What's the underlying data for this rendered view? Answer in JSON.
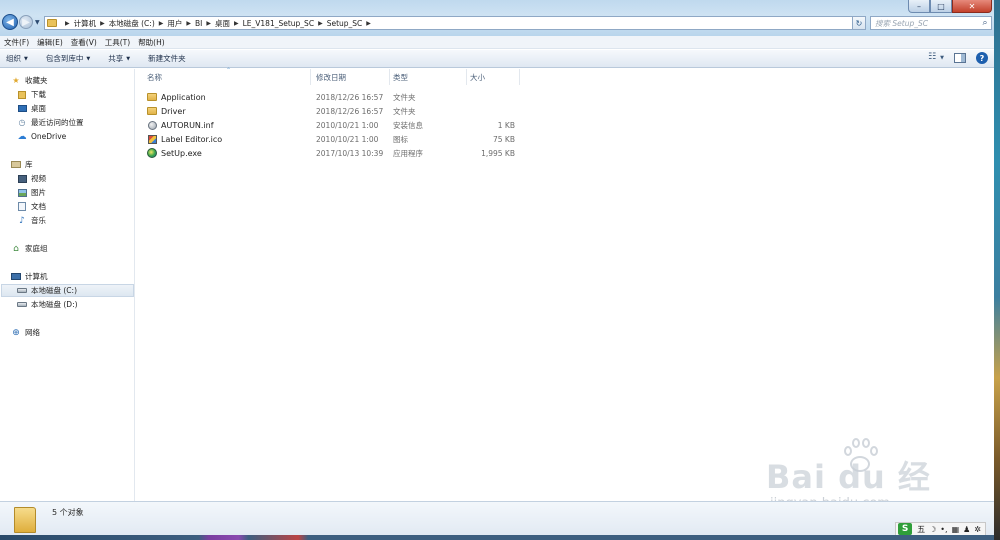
{
  "window": {
    "controls": {
      "minimize": "–",
      "maximize": "□",
      "close": "✕"
    }
  },
  "address": {
    "crumbs": [
      "计算机",
      "本地磁盘 (C:)",
      "用户",
      "BI",
      "桌面",
      "LE_V181_Setup_SC",
      "Setup_SC"
    ]
  },
  "search": {
    "placeholder": "搜索 Setup_SC"
  },
  "menu": [
    "文件(F)",
    "编辑(E)",
    "查看(V)",
    "工具(T)",
    "帮助(H)"
  ],
  "toolbar": {
    "organize": "组织",
    "include_library": "包含到库中",
    "share": "共享",
    "new_folder": "新建文件夹"
  },
  "nav": {
    "favorites": "收藏夹",
    "downloads": "下载",
    "desktop": "桌面",
    "recent": "最近访问的位置",
    "onedrive": "OneDrive",
    "libraries": "库",
    "videos": "视频",
    "pictures": "图片",
    "documents": "文档",
    "music": "音乐",
    "homegroup": "家庭组",
    "computer": "计算机",
    "drive_c": "本地磁盘 (C:)",
    "drive_d": "本地磁盘 (D:)",
    "network": "网络"
  },
  "columns": {
    "name": "名称",
    "date": "修改日期",
    "type": "类型",
    "size": "大小"
  },
  "files": [
    {
      "name": "Application",
      "date": "2018/12/26 16:57",
      "type": "文件夹",
      "size": "",
      "icon": "folder-icon"
    },
    {
      "name": "Driver",
      "date": "2018/12/26 16:57",
      "type": "文件夹",
      "size": "",
      "icon": "folder-icon"
    },
    {
      "name": "AUTORUN.inf",
      "date": "2010/10/21 1:00",
      "type": "安装信息",
      "size": "1 KB",
      "icon": "setup-info-icon"
    },
    {
      "name": "Label Editor.ico",
      "date": "2010/10/21 1:00",
      "type": "图标",
      "size": "75 KB",
      "icon": "image-icon"
    },
    {
      "name": "SetUp.exe",
      "date": "2017/10/13 10:39",
      "type": "应用程序",
      "size": "1,995 KB",
      "icon": "application-icon"
    }
  ],
  "status": {
    "count": "5 个对象"
  },
  "watermark": {
    "brand": "Bai du 经验",
    "url": "jingyan.baidu.com"
  },
  "ime": {
    "logo": "S",
    "mode": "五"
  }
}
